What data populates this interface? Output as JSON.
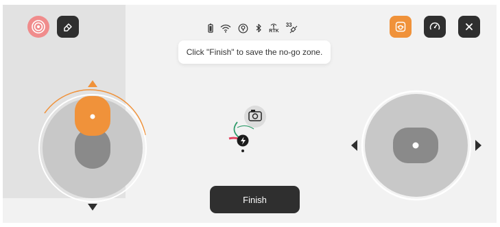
{
  "toolbar_left": {
    "record_icon": "record-icon",
    "eraser_icon": "eraser-icon"
  },
  "status_bar": {
    "battery_icon": "battery-icon",
    "wifi_icon": "wifi-icon",
    "location_icon": "location-icon",
    "bluetooth_icon": "bluetooth-icon",
    "rtk_label": "RTK",
    "satellite_count": "33"
  },
  "tooltip": {
    "text": "Click \"Finish\" to save the no-go zone."
  },
  "toolbar_right": {
    "visibility_icon": "eye-toggle-icon",
    "speed_icon": "speedometer-icon",
    "close_icon": "close-icon"
  },
  "finish_button": {
    "label": "Finish"
  },
  "colors": {
    "accent_orange": "#f0923a",
    "record_red": "#f08c8c",
    "dark_button": "#2f2f2f"
  }
}
